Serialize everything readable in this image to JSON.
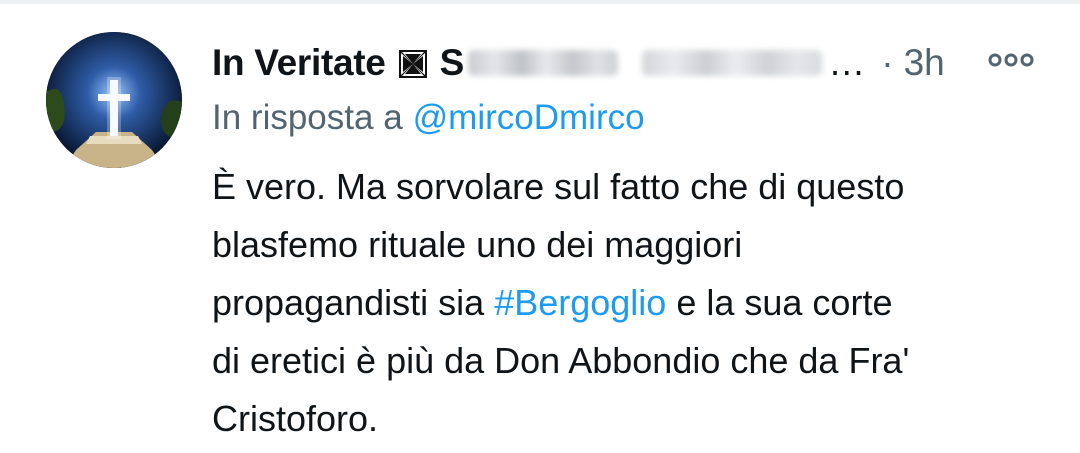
{
  "tweet": {
    "display_name": "In Veritate",
    "badge_symbol": "✠",
    "handle_initial": "S",
    "handle_ellipsis": "…",
    "separator": "·",
    "timestamp": "3h",
    "reply_prefix": "In risposta a",
    "reply_to": "@mircoDmirco",
    "body": {
      "line1": "È vero. Ma sorvolare sul fatto che di questo",
      "line2": "blasfemo rituale uno dei maggiori",
      "line3_before": "propagandisti sia",
      "hashtag": "#Bergoglio",
      "line3_after": "e la sua corte",
      "line4": "di eretici è più da Don Abbondio che da Fra'",
      "line5": "Cristoforo."
    }
  },
  "icons": {
    "avatar": "cross-on-monument-night-avatar",
    "badge": "maltese-cross-icon",
    "more": "more-options-icon"
  },
  "colors": {
    "text_primary": "#0f1419",
    "text_secondary": "#536471",
    "link": "#1d9bf0"
  }
}
